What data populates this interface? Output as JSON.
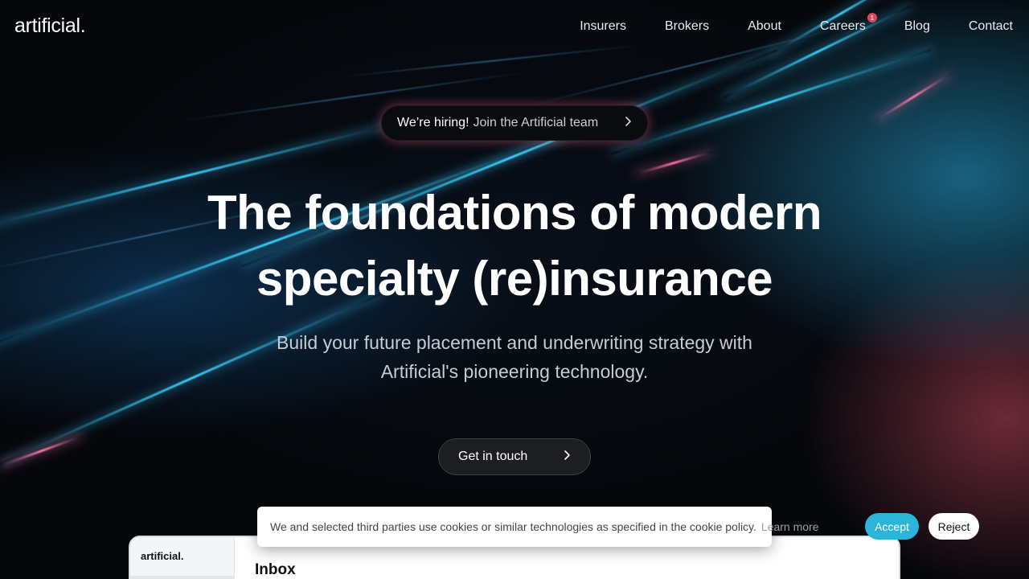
{
  "brand": {
    "logo": "artificial."
  },
  "nav": {
    "items": [
      {
        "label": "Insurers"
      },
      {
        "label": "Brokers"
      },
      {
        "label": "About"
      },
      {
        "label": "Careers",
        "badge": "1"
      },
      {
        "label": "Blog"
      },
      {
        "label": "Contact"
      }
    ]
  },
  "hiring_pill": {
    "strong": "We’re hiring!",
    "soft": "Join the Artificial team",
    "icon": "chevron-right-icon"
  },
  "hero": {
    "headline_line1": "The foundations of modern",
    "headline_line2": "specialty (re)insurance",
    "sub_line1": "Build your future placement and underwriting strategy with",
    "sub_line2": "Artificial's pioneering technology.",
    "cta_label": "Get in touch"
  },
  "app_preview": {
    "brand": "artificial.",
    "title": "Inbox"
  },
  "cookie_banner": {
    "text": "We and selected third parties use cookies or similar technologies as specified in the cookie policy.",
    "learn_more": "Learn more",
    "accept": "Accept",
    "reject": "Reject"
  },
  "colors": {
    "accent": "#2bb5d9",
    "badge": "#e0455a",
    "background": "#05070b"
  }
}
